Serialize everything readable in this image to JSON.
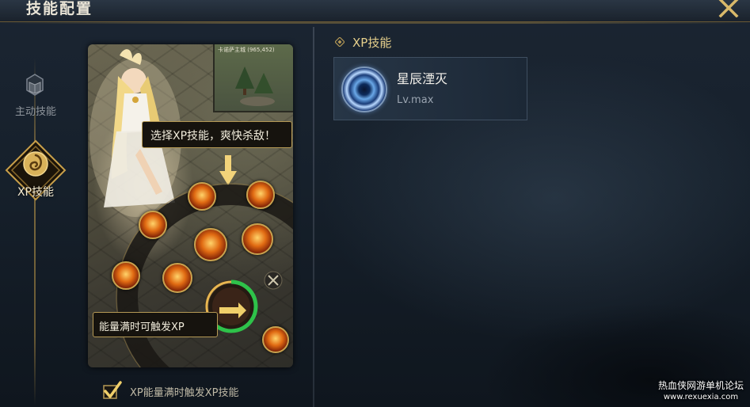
{
  "window": {
    "title": "技能配置",
    "close_icon": "close-icon"
  },
  "sidebar": {
    "tabs": [
      {
        "label": "主动技能",
        "icon": "book-icon",
        "active": false
      },
      {
        "label": "XP技能",
        "icon": "xp-emblem-icon",
        "active": true
      }
    ]
  },
  "promo": {
    "minimap_label": "卡诺萨主城 (965,452)",
    "callout_top": "选择XP技能，爽快杀敌！",
    "callout_bottom": "能量满时可触发XP"
  },
  "auto_trigger": {
    "label": "XP能量满时触发XP技能",
    "checked": true
  },
  "xp_skills": {
    "section_title": "XP技能",
    "items": [
      {
        "name": "星辰湮灭",
        "level": "Lv.max",
        "icon": "vortex-skill-icon"
      }
    ]
  },
  "watermark": {
    "line1": "热血侠网游单机论坛",
    "line2": "www.rexuexia.com"
  },
  "colors": {
    "gold_accent": "#e5cf8b",
    "frame_gold": "#b59955",
    "panel_dark": "#16202b"
  }
}
